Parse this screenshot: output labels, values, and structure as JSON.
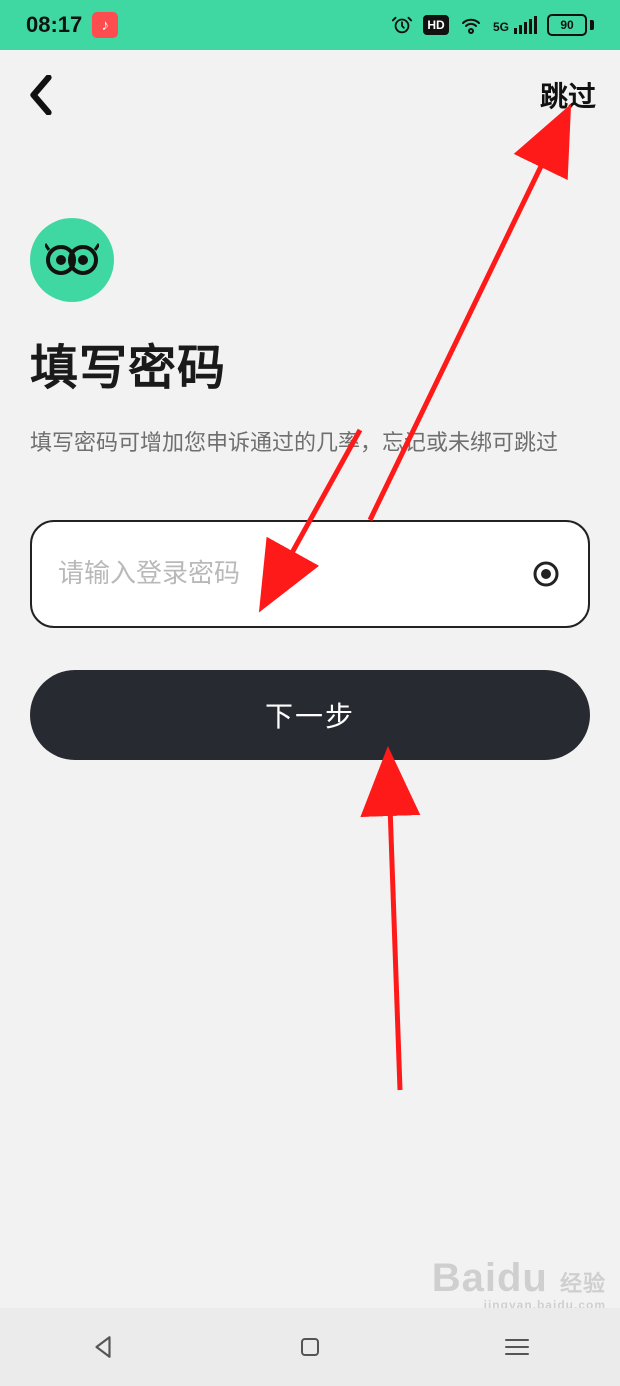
{
  "status": {
    "time": "08:17",
    "music_icon": "♪",
    "hd": "HD",
    "network_label": "5G",
    "battery_pct": "90"
  },
  "nav": {
    "skip": "跳过"
  },
  "page": {
    "title": "填写密码",
    "subtitle": "填写密码可增加您申诉通过的几率，忘记或未绑可跳过",
    "placeholder": "请输入登录密码",
    "next": "下一步"
  },
  "watermark": {
    "brand": "Baidu",
    "sub": "经验",
    "url": "jingyan.baidu.com"
  }
}
